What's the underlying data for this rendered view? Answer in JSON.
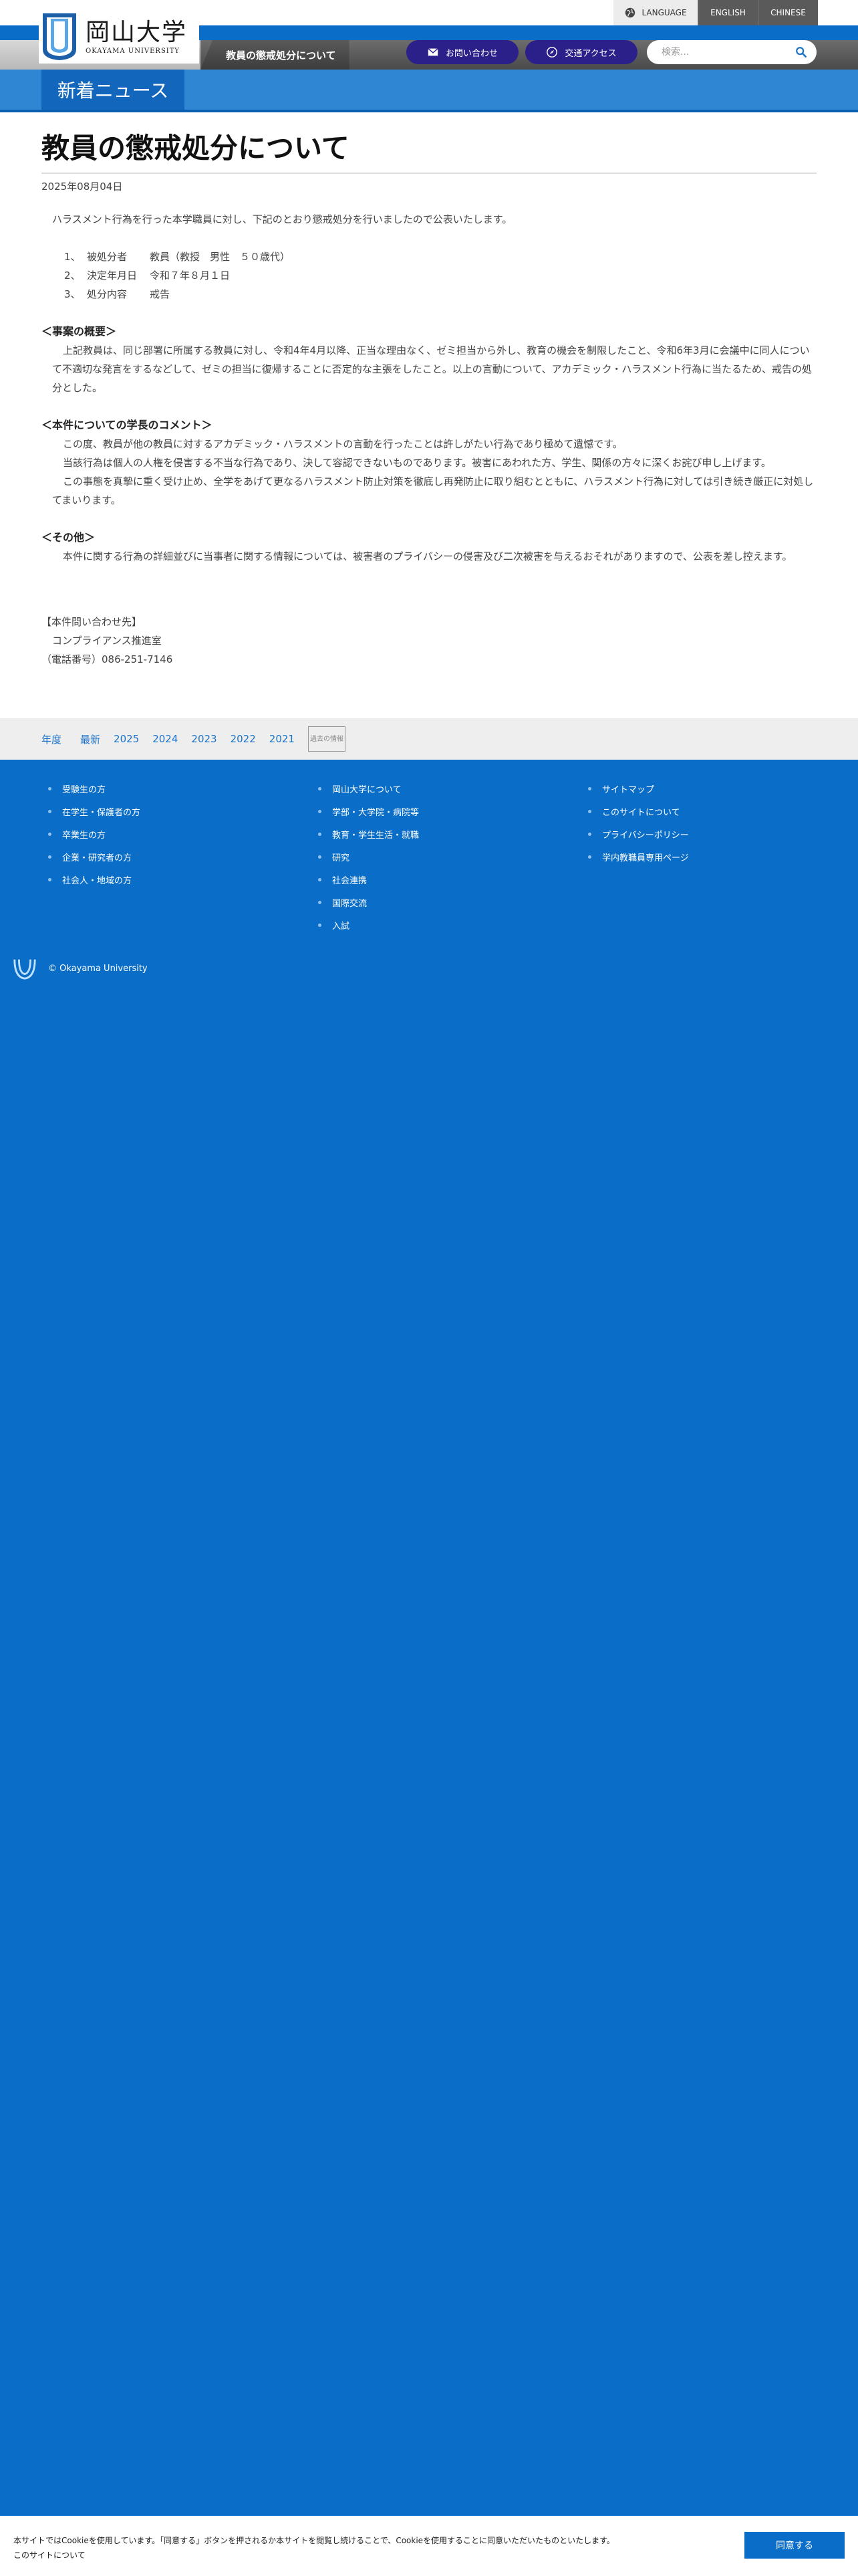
{
  "language_bar": {
    "label": "LANGUAGE",
    "options": [
      "ENGLISH",
      "CHINESE"
    ]
  },
  "header": {
    "logo_ja": "岡山大学",
    "logo_en": "OKAYAMA UNIVERSITY",
    "breadcrumb_title": "教員の懲戒処分について",
    "contact_label": "お問い合わせ",
    "access_label": "交通アクセス",
    "search_placeholder": "検索..."
  },
  "section_tab": "新着ニュース",
  "article": {
    "title": "教員の懲戒処分について",
    "date": "2025年08月04日",
    "intro": "ハラスメント行為を行った本学職員に対し、下記のとおり懲戒処分を行いましたので公表いたします。",
    "items": [
      {
        "num": "1、",
        "label": "被処分者",
        "value": "教員（教授　男性　５０歳代）"
      },
      {
        "num": "2、",
        "label": "決定年月日",
        "value": "令和７年８月１日"
      },
      {
        "num": "3、",
        "label": "処分内容",
        "value": "戒告"
      }
    ],
    "overview_head": "＜事案の概要＞",
    "overview_body": "上記教員は、同じ部署に所属する教員に対し、令和4年4月以降、正当な理由なく、ゼミ担当から外し、教育の機会を制限したこと、令和6年3月に会議中に同人について不適切な発言をするなどして、ゼミの担当に復帰することに否定的な主張をしたこと。以上の言動について、アカデミック・ハラスメント行為に当たるため、戒告の処分とした。",
    "comment_head": "＜本件についての学長のコメント＞",
    "comment_lines": [
      "この度、教員が他の教員に対するアカデミック・ハラスメントの言動を行ったことは許しがたい行為であり極めて遺憾です。",
      "当該行為は個人の人権を侵害する不当な行為であり、決して容認できないものであります。被害にあわれた方、学生、関係の方々に深くお詫び申し上げます。",
      "この事態を真摯に重く受け止め、全学をあげて更なるハラスメント防止対策を徹底し再発防止に取り組むとともに、ハラスメント行為に対しては引き続き厳正に対処してまいります。"
    ],
    "other_head": "＜その他＞",
    "other_body": "本件に関する行為の詳細並びに当事者に関する情報については、被害者のプライバシーの侵害及び二次被害を与えるおそれがありますので、公表を差し控えます。",
    "inquiry_head": "【本件問い合わせ先】",
    "inquiry_dept": "コンプライアンス推進室",
    "inquiry_phone": "（電話番号）086-251-7146"
  },
  "year_nav": {
    "label": "年度",
    "years": [
      "最新",
      "2025",
      "2024",
      "2023",
      "2022",
      "2021"
    ],
    "past_tag": "過去の情報"
  },
  "footer": {
    "col1": [
      "受験生の方",
      "在学生・保護者の方",
      "卒業生の方",
      "企業・研究者の方",
      "社会人・地域の方"
    ],
    "col2": [
      "岡山大学について",
      "学部・大学院・病院等",
      "教育・学生生活・就職",
      "研究",
      "社会連携",
      "国際交流",
      "入試"
    ],
    "col3": [
      "サイトマップ",
      "このサイトについて",
      "プライバシーポリシー",
      "学内教職員専用ページ"
    ],
    "copyright": "© Okayama University"
  },
  "cookie": {
    "text": "本サイトではCookieを使用しています。「同意する」ボタンを押されるか本サイトを閲覧し続けることで、Cookieを使用することに同意いただいたものといたします。",
    "link": "このサイトについて",
    "button": "同意する"
  },
  "colors": {
    "brand_blue": "#0a6ec8",
    "pill_indigo": "#2b1f8a",
    "news_band": "#2f86d2"
  }
}
